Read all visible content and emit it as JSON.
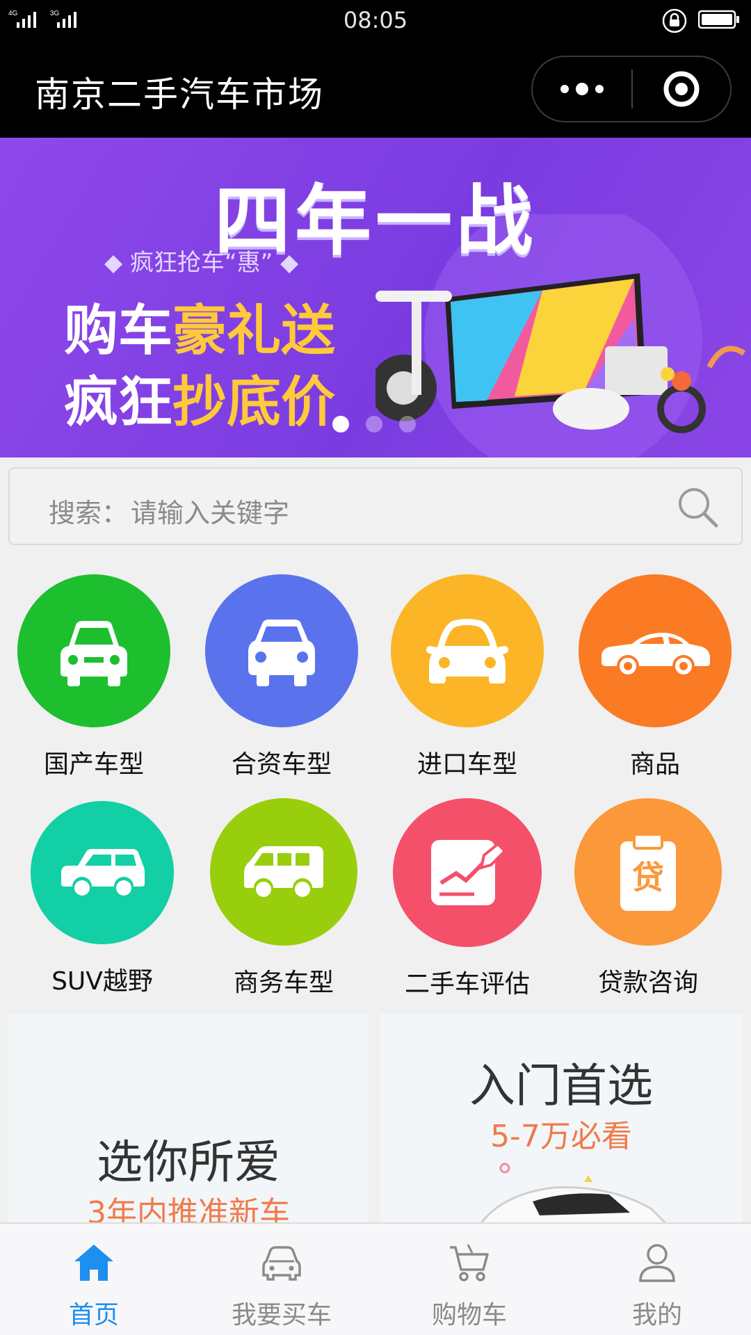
{
  "status_bar": {
    "time": "08:05",
    "network_1": "4G",
    "network_2": "3G"
  },
  "nav": {
    "title": "南京二手汽车市场"
  },
  "banner": {
    "title": "四年一战",
    "subtitle": "◆ 疯狂抢车“惠” ◆",
    "line1_a": "购车",
    "line1_b": "豪礼送",
    "line2_a": "疯狂",
    "line2_b": "抄底价",
    "slide_count": 3,
    "active_slide": 1
  },
  "search": {
    "label": "搜索：",
    "placeholder": "请输入关键字"
  },
  "categories": [
    {
      "label": "国产车型",
      "color": "#1dbf2f",
      "icon": "car-front-icon"
    },
    {
      "label": "合资车型",
      "color": "#5a73ec",
      "icon": "car-front-icon"
    },
    {
      "label": "进口车型",
      "color": "#fbb526",
      "icon": "car-front-icon"
    },
    {
      "label": "商品",
      "color": "#fb7a24",
      "icon": "car-side-icon"
    },
    {
      "label": "SUV越野",
      "color": "#13cfa5",
      "icon": "suv-icon"
    },
    {
      "label": "商务车型",
      "color": "#99ce0c",
      "icon": "van-icon"
    },
    {
      "label": "二手车评估",
      "color": "#f4506a",
      "icon": "evaluation-icon"
    },
    {
      "label": "贷款咨询",
      "color": "#fb983a",
      "icon": "loan-icon"
    }
  ],
  "promos": [
    {
      "title": "选你所爱",
      "subtitle": "3年内推准新车"
    },
    {
      "title": "入门首选",
      "subtitle": "5-7万必看"
    }
  ],
  "tabs": [
    {
      "label": "首页",
      "icon": "home-icon",
      "active": true
    },
    {
      "label": "我要买车",
      "icon": "car-icon",
      "active": false
    },
    {
      "label": "购物车",
      "icon": "cart-icon",
      "active": false
    },
    {
      "label": "我的",
      "icon": "user-icon",
      "active": false
    }
  ],
  "colors": {
    "accent": "#1d8ff0",
    "promo_subtitle": "#f07a4a",
    "banner": "#8f48ea"
  }
}
